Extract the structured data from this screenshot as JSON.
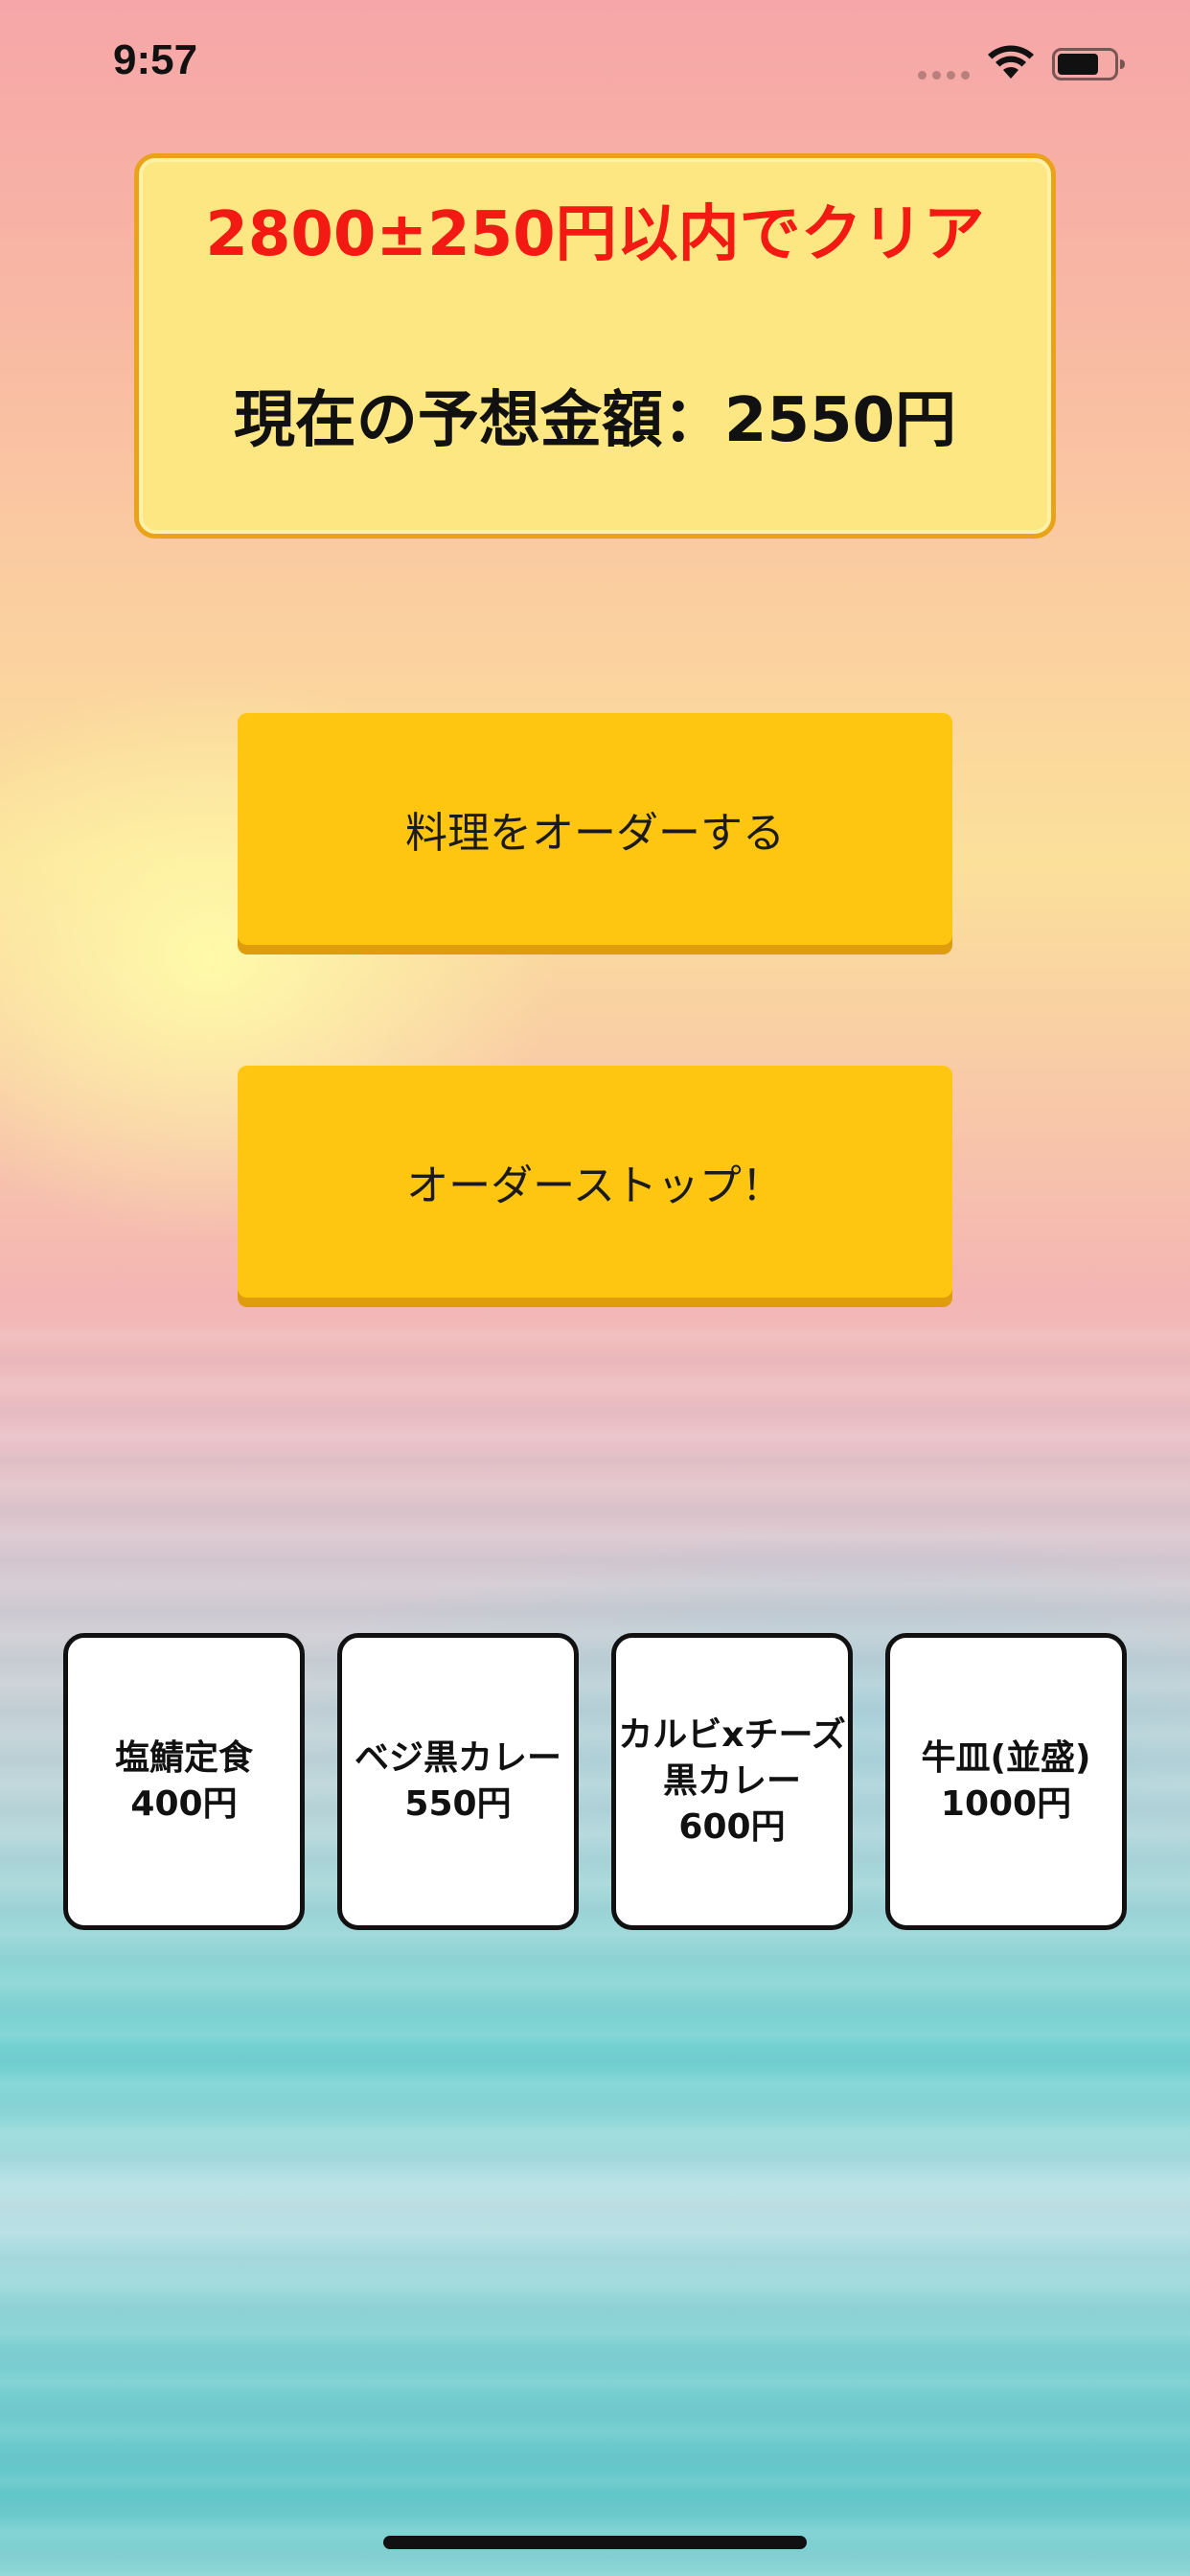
{
  "status_bar": {
    "time": "9:57",
    "icons": [
      "signal-icon",
      "wifi-icon",
      "battery-icon"
    ]
  },
  "target": {
    "clear_condition": "2800±250円以内でクリア",
    "estimate_label": "現在の予想金額：2550円"
  },
  "buttons": {
    "order_label": "料理をオーダーする",
    "stop_label": "オーダーストップ！"
  },
  "menu": {
    "items": [
      {
        "name_lines": [
          "塩鯖定食"
        ],
        "price": "400円"
      },
      {
        "name_lines": [
          "ベジ黒カレー"
        ],
        "price": "550円"
      },
      {
        "name_lines": [
          "カルビxチーズ",
          "黒カレー"
        ],
        "price": "600円"
      },
      {
        "name_lines": [
          "牛皿(並盛)"
        ],
        "price": "1000円"
      }
    ]
  },
  "colors": {
    "target_text": "#f21a12",
    "target_box": "#fde782",
    "target_border": "#e9a31a",
    "button": "#fec611",
    "button_shadow": "#df9d0d",
    "card_border": "#111111"
  }
}
